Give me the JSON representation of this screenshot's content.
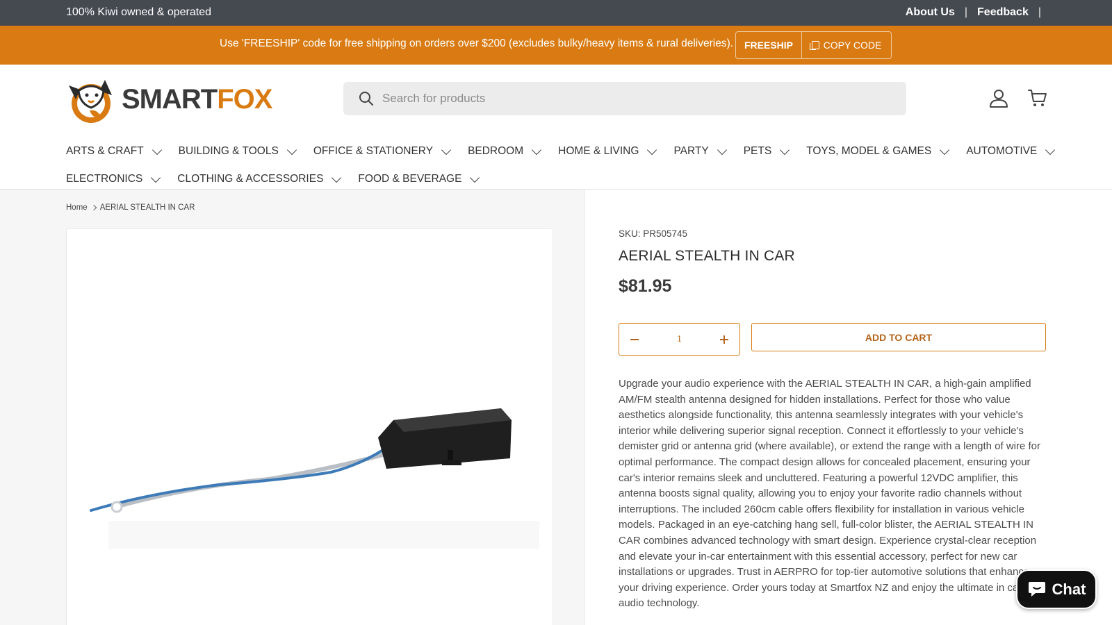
{
  "topbar": {
    "tagline": "100% Kiwi owned & operated",
    "links": [
      "About Us",
      "Feedback"
    ],
    "separator": "|"
  },
  "promo": {
    "message": "Use 'FREESHIP' code for free shipping on orders over $200 (excludes bulky/heavy items & rural deliveries).",
    "code": "FREESHIP",
    "copy_label": "COPY CODE"
  },
  "header": {
    "logo_smart": "SMART",
    "logo_fox": "FOX",
    "search_placeholder": "Search for products",
    "brand_color": "#d97b12"
  },
  "nav": {
    "row1": [
      "ARTS & CRAFT",
      "BUILDING & TOOLS",
      "OFFICE & STATIONERY",
      "BEDROOM",
      "HOME & LIVING",
      "PARTY",
      "PETS",
      "TOYS, MODEL & GAMES",
      "AUTOMOTIVE"
    ],
    "row2": [
      "ELECTRONICS",
      "CLOTHING & ACCESSORIES",
      "FOOD & BEVERAGE"
    ]
  },
  "breadcrumb": {
    "home": "Home",
    "current": "AERIAL STEALTH IN CAR"
  },
  "product": {
    "sku": "SKU: PR505745",
    "title": "AERIAL STEALTH IN CAR",
    "price": "$81.95",
    "quantity": "1",
    "add_to_cart": "ADD TO CART",
    "description": "Upgrade your audio experience with the AERIAL STEALTH IN CAR, a high-gain amplified AM/FM stealth antenna designed for hidden installations. Perfect for those who value aesthetics alongside functionality, this antenna seamlessly integrates with your vehicle's interior while delivering superior signal reception. Connect it effortlessly to your vehicle's demister grid or antenna grid (where available), or extend the range with a length of wire for optimal performance. The compact design allows for concealed placement, ensuring your car's interior remains sleek and uncluttered. Featuring a powerful 12VDC amplifier, this antenna boosts signal quality, allowing you to enjoy your favorite radio channels without interruptions. The included 260cm cable offers flexibility for installation in various vehicle models. Packaged in an eye-catching hang sell, full-color blister, the AERIAL STEALTH IN CAR combines advanced technology with smart design. Experience crystal-clear reception and elevate your in-car entertainment with this essential accessory, perfect for new car installations or upgrades. Trust in AERPRO for top-tier automotive solutions that enhance your driving experience. Order yours today at Smartfox NZ and enjoy the ultimate in car audio technology."
  },
  "chat": {
    "label": "Chat"
  }
}
